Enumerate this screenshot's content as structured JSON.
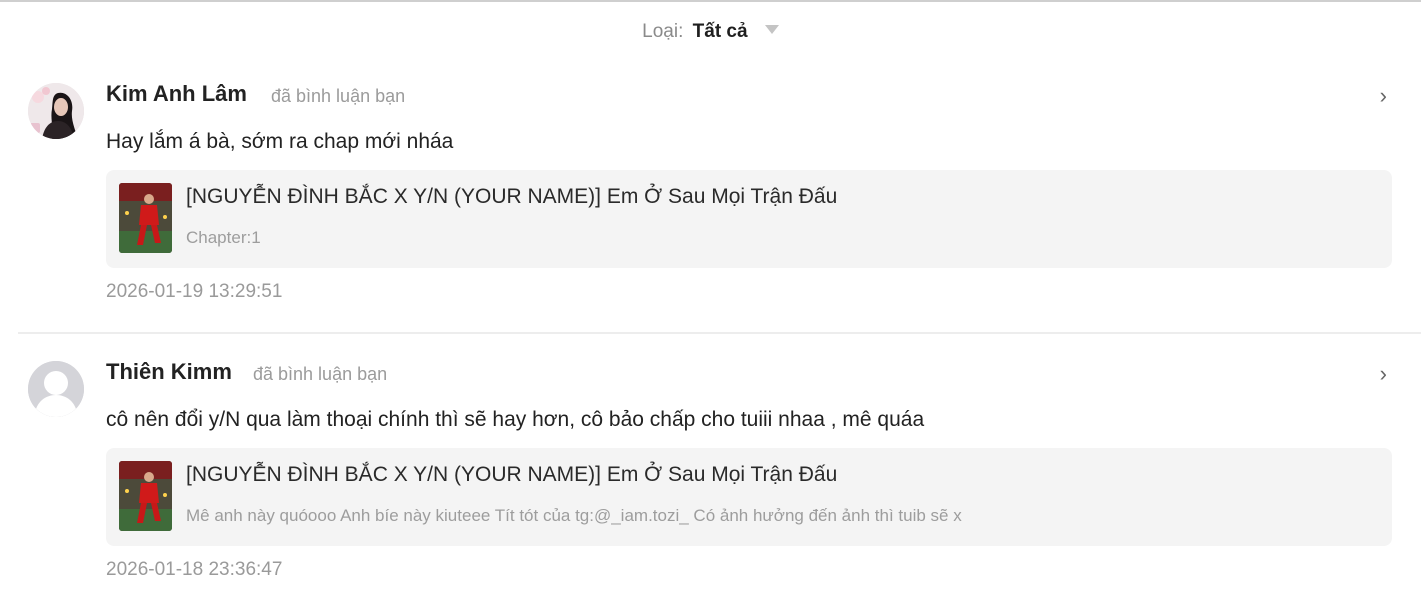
{
  "filter": {
    "label": "Loại:",
    "value": "Tất cả",
    "icon": "caret-down-icon"
  },
  "notifications": [
    {
      "user": "Kim Anh Lâm",
      "action": "đã bình luận bạn",
      "comment": "Hay lắm á bà, sớm ra chap mới nháa",
      "story_title": "[NGUYỄN ĐÌNH BẮC X Y/N (YOUR NAME)] Em Ở Sau Mọi Trận Đấu",
      "story_sub": "Chapter:1",
      "time": "2026-01-19 13:29:51",
      "chevron": "›"
    },
    {
      "user": "Thiên Kimm",
      "action": "đã bình luận bạn",
      "comment": "cô nên đổi y/N qua làm thoại chính thì sẽ hay hơn, cô bảo chấp cho tuiii nhaa , mê quáa",
      "story_title": "[NGUYỄN ĐÌNH BẮC X Y/N (YOUR NAME)] Em Ở Sau Mọi Trận Đấu",
      "story_sub": "Mê anh này quóooo Anh bíe này kiuteee  Tít tót của tg:@_iam.tozi_ Có ảnh hưởng đến ảnh thì tuib sẽ x",
      "time": "2026-01-18 23:36:47",
      "chevron": "›"
    }
  ]
}
